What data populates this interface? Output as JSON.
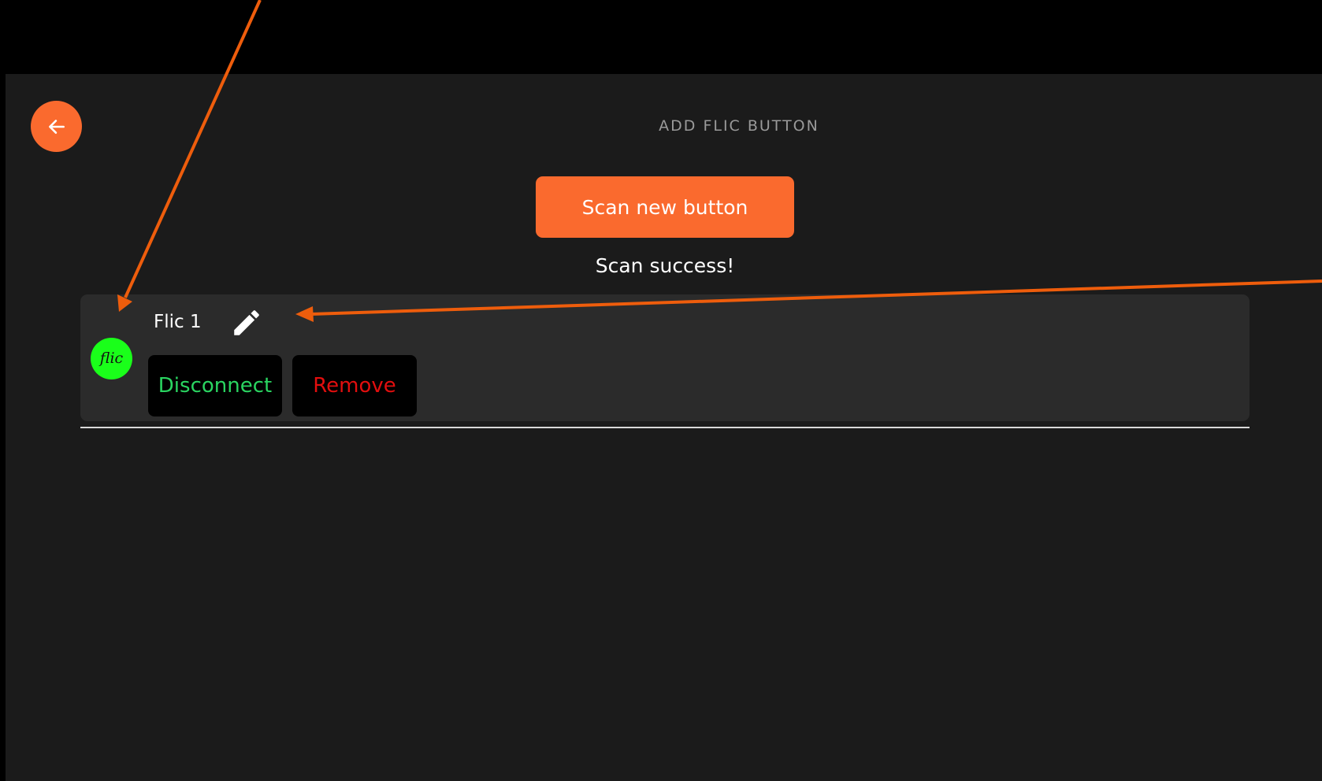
{
  "header": {
    "title": "ADD FLIC BUTTON",
    "back_icon": "arrow-left-icon"
  },
  "scan": {
    "button_label": "Scan new button",
    "status": "Scan success!"
  },
  "devices": [
    {
      "name": "Flic 1",
      "logo_text": "flic",
      "logo_color": "#1aff1a",
      "edit_icon": "pencil-icon",
      "disconnect_label": "Disconnect",
      "remove_label": "Remove"
    }
  ],
  "colors": {
    "accent": "#fa6a2e",
    "background": "#1b1b1b",
    "card": "#2b2b2b",
    "connected_text": "#2ad561",
    "remove_text": "#e20e0e",
    "annotation_arrow": "#ee5d0c"
  }
}
